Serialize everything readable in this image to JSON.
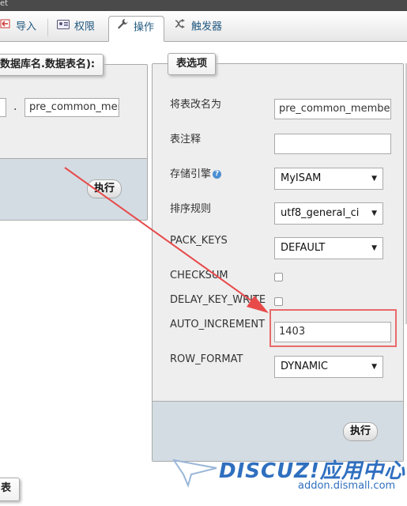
{
  "window": {
    "title_fragment": "et"
  },
  "tabs": [
    {
      "label": "导入",
      "icon": "import-icon"
    },
    {
      "label": "权限",
      "icon": "privileges-icon"
    },
    {
      "label": "操作",
      "icon": "wrench-icon",
      "active": true
    },
    {
      "label": "触发器",
      "icon": "trigger-icon"
    }
  ],
  "left_panel": {
    "legend": "数据库名.数据表名):",
    "separator": ".",
    "table_name_value": "pre_common_mem",
    "execute_label": "执行"
  },
  "table_options": {
    "legend": "表选项",
    "rename_label": "将表改名为",
    "rename_value": "pre_common_member",
    "comment_label": "表注释",
    "comment_value": "",
    "engine_label": "存储引擎",
    "engine_value": "MyISAM",
    "collation_label": "排序规则",
    "collation_value": "utf8_general_ci",
    "pack_keys_label": "PACK_KEYS",
    "pack_keys_value": "DEFAULT",
    "checksum_label": "CHECKSUM",
    "delay_key_write_label": "DELAY_KEY_WRITE",
    "auto_increment_label": "AUTO_INCREMENT",
    "auto_increment_value": "1403",
    "row_format_label": "ROW_FORMAT",
    "row_format_value": "DYNAMIC",
    "execute_label": "执行"
  },
  "bottom_left": {
    "legend_fragment": "表"
  },
  "watermark": {
    "brand": "DISCUZ!应用中心",
    "url": "addon.dismall.com"
  },
  "colors": {
    "accent": "#235a81",
    "highlight": "#e96a6a",
    "arrow": "#e84a4a"
  }
}
